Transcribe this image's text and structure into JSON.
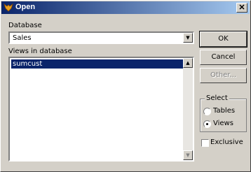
{
  "window": {
    "title": "Open",
    "icon": "fox-app-icon",
    "close_glyph": "✕"
  },
  "database": {
    "label": "Database",
    "value": "Sales",
    "arrow": "▼"
  },
  "views_list": {
    "label": "Views in database",
    "items": [
      "sumcust"
    ],
    "scroll_up": "▲",
    "scroll_down": "▼"
  },
  "buttons": {
    "ok": "OK",
    "cancel": "Cancel",
    "other": "Other..."
  },
  "select_group": {
    "title": "Select",
    "options": [
      "Tables",
      "Views"
    ],
    "selected": "Views"
  },
  "exclusive": {
    "label": "Exclusive",
    "checked": false
  },
  "colors": {
    "titlebar_start": "#0a246a",
    "titlebar_end": "#a6caf0",
    "selection": "#0a246a",
    "face": "#d4d0c8"
  }
}
